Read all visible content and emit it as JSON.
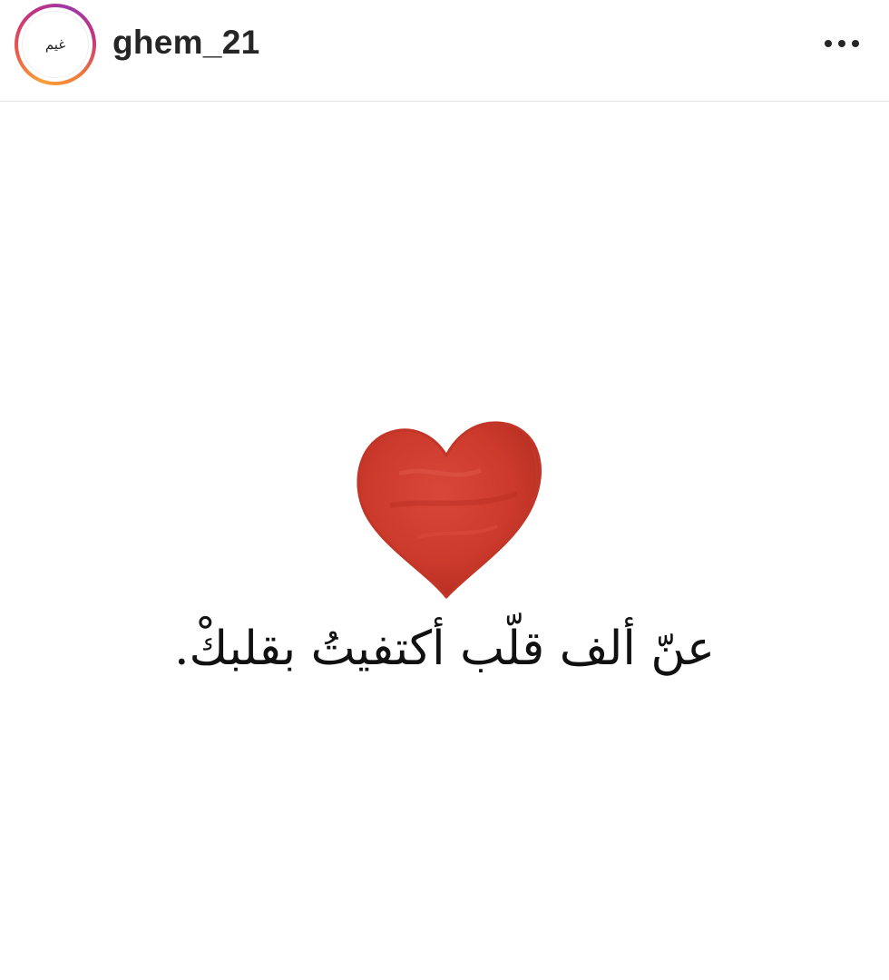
{
  "header": {
    "username": "ghem_21",
    "avatar_text": "غيم",
    "more_icon": "more-horizontal-icon"
  },
  "post": {
    "caption_text": "عنّ ألف قلّب أكتفيتُ بقلبكْ.",
    "heart_icon": "heart-icon",
    "heart_color": "#cc3a2c"
  },
  "colors": {
    "ring_start": "#f8a13a",
    "ring_end": "#9b3aa8",
    "text": "#262626"
  }
}
